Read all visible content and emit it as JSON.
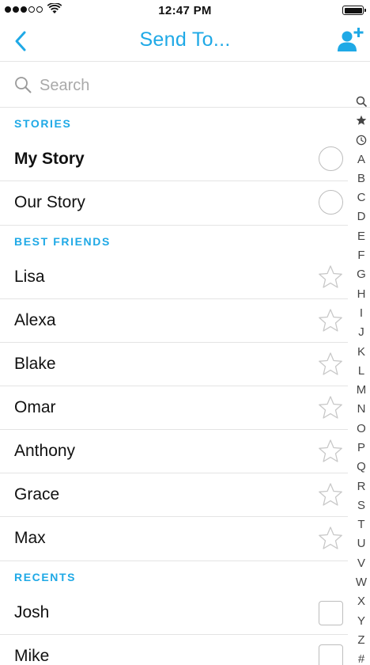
{
  "status_bar": {
    "time": "12:47 PM",
    "signal_bars": 5,
    "signal_filled": 3
  },
  "header": {
    "title": "Send To...",
    "back_icon": "chevron-left-icon",
    "add_icon": "add-friend-icon",
    "accent_color": "#1fa9e6"
  },
  "search": {
    "placeholder": "Search",
    "value": ""
  },
  "sections": {
    "stories": {
      "title": "STORIES",
      "items": [
        {
          "label": "My Story"
        },
        {
          "label": "Our Story"
        }
      ]
    },
    "best_friends": {
      "title": "BEST FRIENDS",
      "items": [
        {
          "label": "Lisa"
        },
        {
          "label": "Alexa"
        },
        {
          "label": "Blake"
        },
        {
          "label": "Omar"
        },
        {
          "label": "Anthony"
        },
        {
          "label": "Grace"
        },
        {
          "label": "Max"
        }
      ]
    },
    "recents": {
      "title": "RECENTS",
      "items": [
        {
          "label": "Josh"
        },
        {
          "label": "Mike"
        }
      ]
    }
  },
  "index_bar": {
    "icon_items": [
      "search-icon",
      "star-icon",
      "clock-icon"
    ],
    "letters": [
      "A",
      "B",
      "C",
      "D",
      "E",
      "F",
      "G",
      "H",
      "I",
      "J",
      "K",
      "L",
      "M",
      "N",
      "O",
      "P",
      "Q",
      "R",
      "S",
      "T",
      "U",
      "V",
      "W",
      "X",
      "Y",
      "Z",
      "#"
    ]
  }
}
